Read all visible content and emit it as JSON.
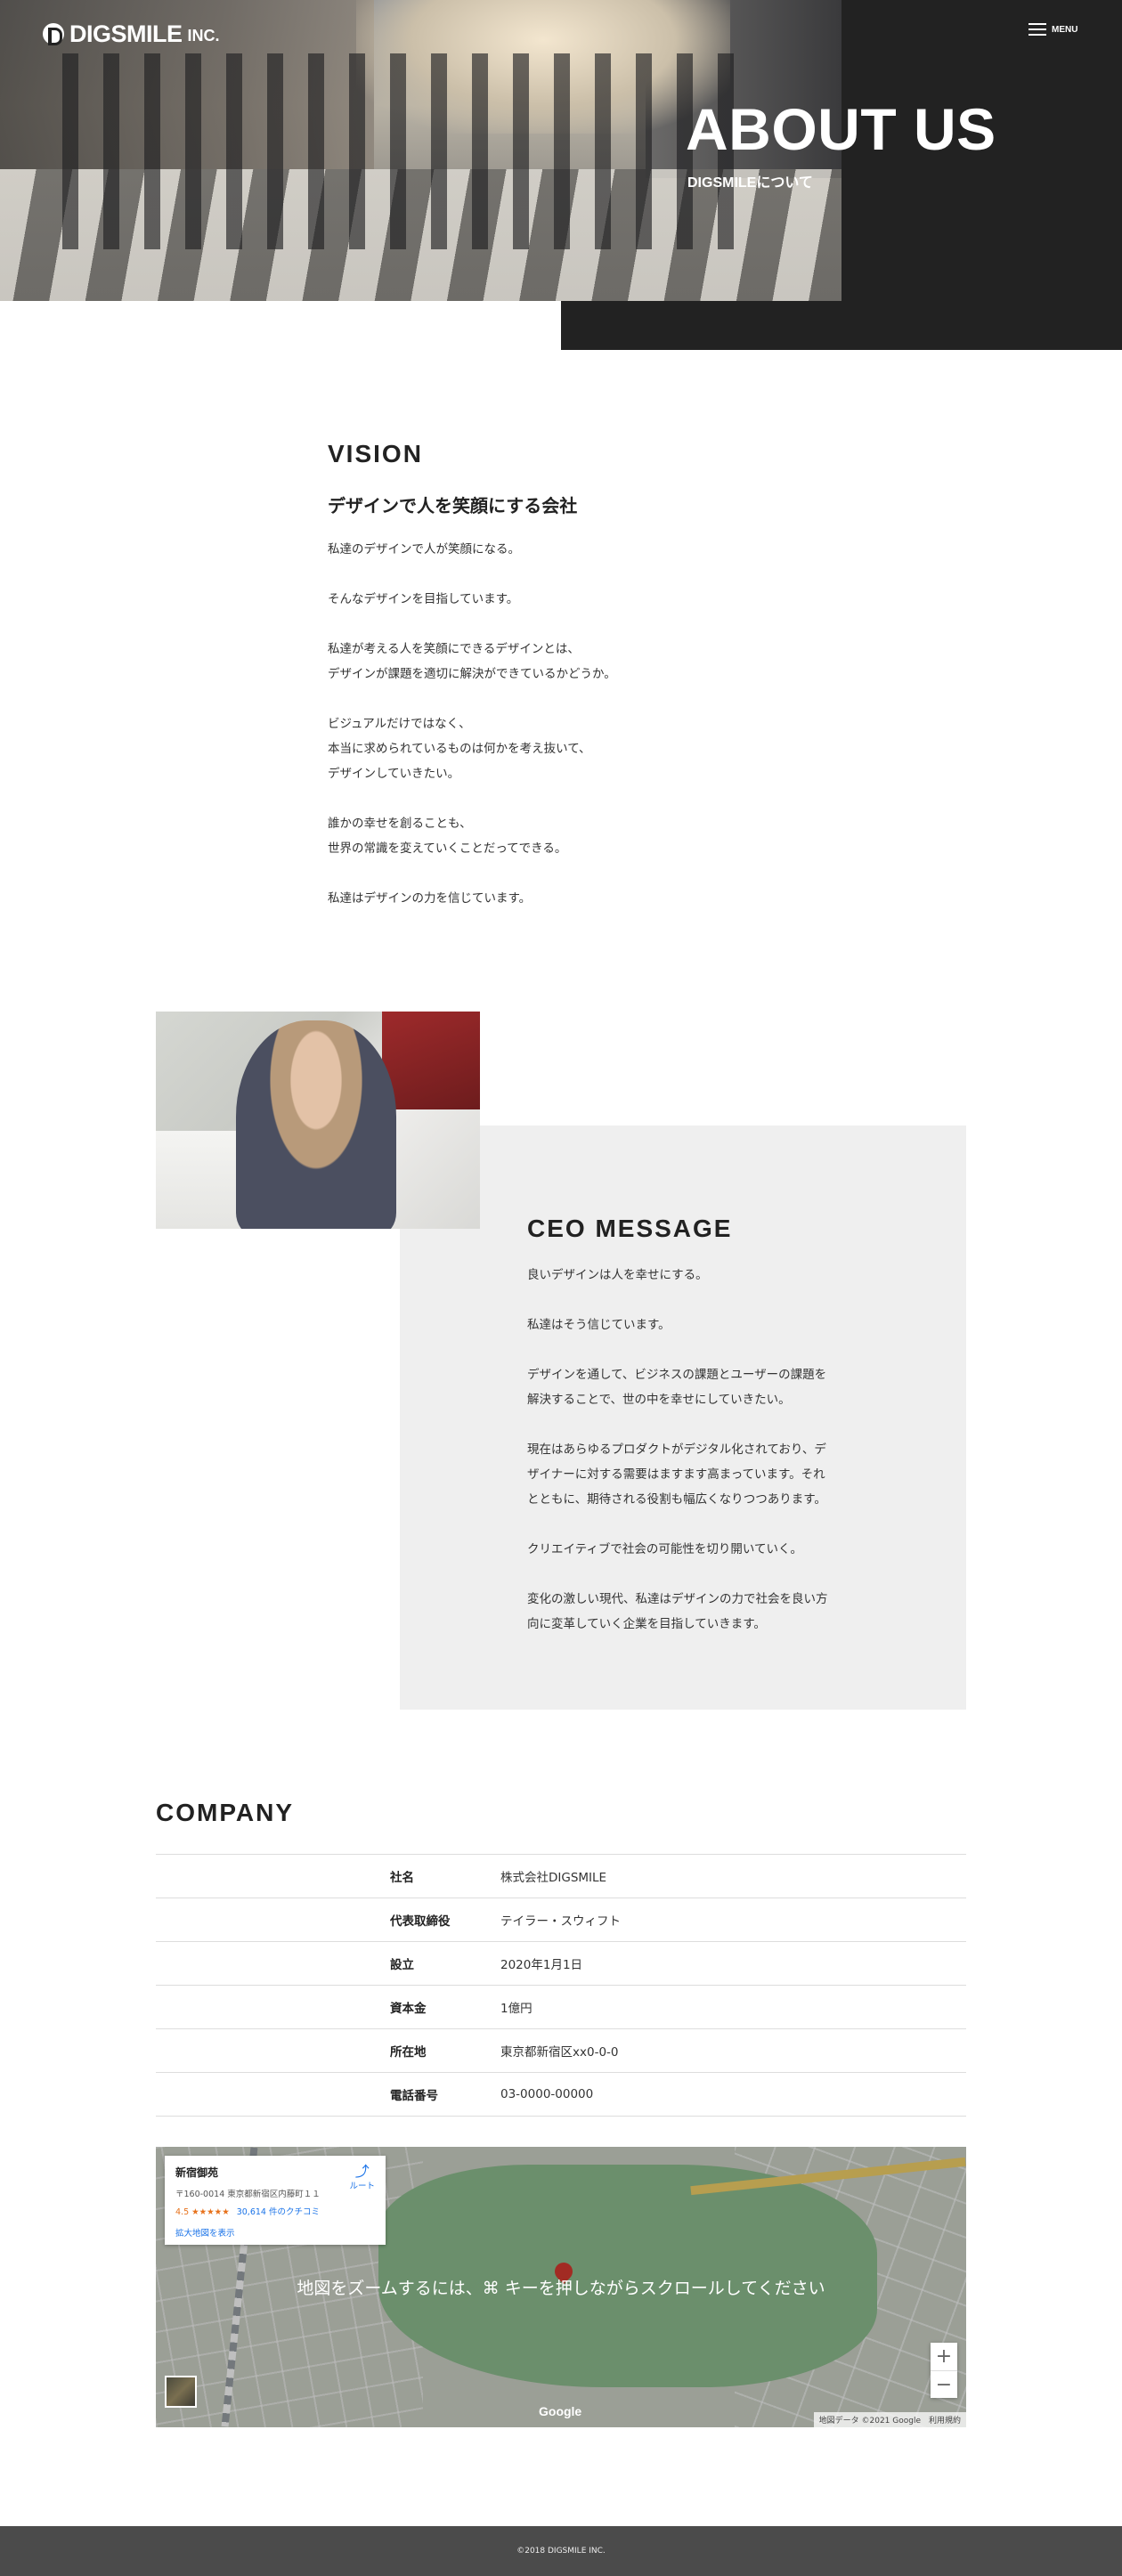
{
  "header": {
    "logo_text": "DIGSMILE",
    "logo_inc": "INC.",
    "menu_label": "MENU",
    "title": "ABOUT US",
    "subtitle": "DIGSMILEについて"
  },
  "vision": {
    "title": "VISION",
    "subtitle": "デザインで人を笑顔にする会社",
    "paragraphs": [
      "私達のデザインで人が笑顔になる。",
      "そんなデザインを目指しています。",
      "私達が考える人を笑顔にできるデザインとは、\nデザインが課題を適切に解決ができているかどうか。",
      "ビジュアルだけではなく、\n本当に求められているものは何かを考え抜いて、\nデザインしていきたい。",
      "誰かの幸せを創ることも、\n世界の常識を変えていくことだってできる。",
      "私達はデザインの力を信じています。"
    ]
  },
  "ceo": {
    "title": "CEO MESSAGE",
    "paragraphs": [
      "良いデザインは人を幸せにする。",
      "私達はそう信じています。",
      "デザインを通して、ビジネスの課題とユーザーの課題を\n解決することで、世の中を幸せにしていきたい。",
      "現在はあらゆるプロダクトがデジタル化されており、デ\nザイナーに対する需要はますます高まっています。それ\nとともに、期待される役割も幅広くなりつつあります。",
      "クリエイティブで社会の可能性を切り開いていく。",
      "変化の激しい現代、私達はデザインの力で社会を良い方\n向に変革していく企業を目指していきます。"
    ]
  },
  "company": {
    "title": "COMPANY",
    "rows": [
      {
        "label": "社名",
        "value": "株式会社DIGSMILE"
      },
      {
        "label": "代表取締役",
        "value": "テイラー・スウィフト"
      },
      {
        "label": "設立",
        "value": "2020年1月1日"
      },
      {
        "label": "資本金",
        "value": "1億円"
      },
      {
        "label": "所在地",
        "value": "東京都新宿区xx0-0-0"
      },
      {
        "label": "電話番号",
        "value": "03-0000-00000"
      }
    ]
  },
  "map": {
    "place_name": "新宿御苑",
    "address": "〒160-0014 東京都新宿区内藤町１１",
    "rating": "4.5 ★★★★★",
    "reviews": "30,614 件のクチコミ",
    "enlarge_link": "拡大地図を表示",
    "route_label": "ルート",
    "overlay_text": "地図をズームするには、⌘ キーを押しながらスクロールしてください",
    "zoom_in": "+",
    "zoom_out": "−",
    "logo": "Google",
    "attribution": "地図データ ©2021 Google　利用規約"
  },
  "footer": {
    "copyright": "©2018 DIGSMILE INC."
  }
}
